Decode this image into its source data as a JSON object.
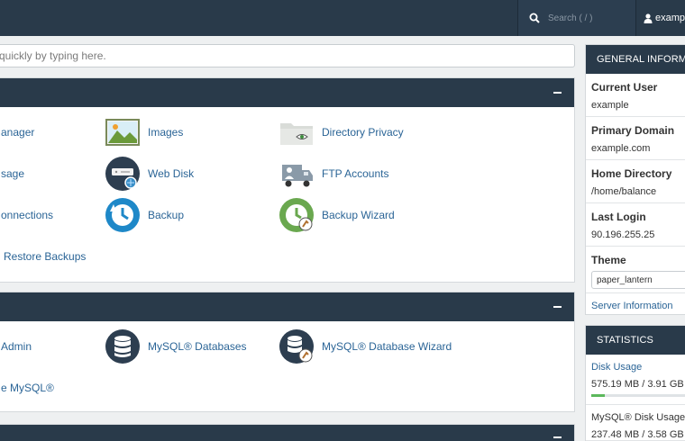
{
  "topbar": {
    "search_placeholder": "Search ( / )",
    "username": "exampl"
  },
  "quickfind": {
    "placeholder": "quickly by typing here."
  },
  "files": {
    "items": [
      {
        "label": "anager",
        "icon": "file-manager-icon"
      },
      {
        "label": "Images",
        "icon": "images-icon"
      },
      {
        "label": "Directory Privacy",
        "icon": "directory-privacy-icon"
      },
      {
        "label": "sage",
        "icon": "disk-usage-icon"
      },
      {
        "label": "Web Disk",
        "icon": "web-disk-icon"
      },
      {
        "label": "FTP Accounts",
        "icon": "ftp-accounts-icon"
      },
      {
        "label": "onnections",
        "icon": "ftp-connections-icon"
      },
      {
        "label": "Backup",
        "icon": "backup-icon"
      },
      {
        "label": "Backup Wizard",
        "icon": "backup-wizard-icon"
      },
      {
        "label": "Restore Backups",
        "icon": "restore-backups-icon"
      }
    ]
  },
  "databases": {
    "items": [
      {
        "label": "Admin",
        "icon": "phpmyadmin-icon"
      },
      {
        "label": "MySQL® Databases",
        "icon": "mysql-databases-icon"
      },
      {
        "label": "MySQL® Database Wizard",
        "icon": "mysql-database-wizard-icon"
      },
      {
        "label": "e MySQL®",
        "icon": "remote-mysql-icon"
      }
    ]
  },
  "general_info": {
    "title": "GENERAL INFORMAT",
    "current_user_label": "Current User",
    "current_user": "example",
    "primary_domain_label": "Primary Domain",
    "primary_domain": "example.com",
    "home_directory_label": "Home Directory",
    "home_directory": "/home/balance",
    "last_login_label": "Last Login",
    "last_login": "90.196.255.25",
    "theme_label": "Theme",
    "theme_value": "paper_lantern",
    "server_info_link": "Server Information"
  },
  "statistics": {
    "title": "STATISTICS",
    "disk_usage_label": "Disk Usage",
    "disk_usage_value": "575.19 MB / 3.91 GB",
    "disk_usage_fraction": 0.147,
    "mysql_disk_label": "MySQL® Disk Usage",
    "mysql_disk_value": "237.48 MB / 3.58 GB"
  },
  "colors": {
    "header": "#293a4a",
    "link": "#2a6496",
    "progress": "#5cb85c"
  }
}
